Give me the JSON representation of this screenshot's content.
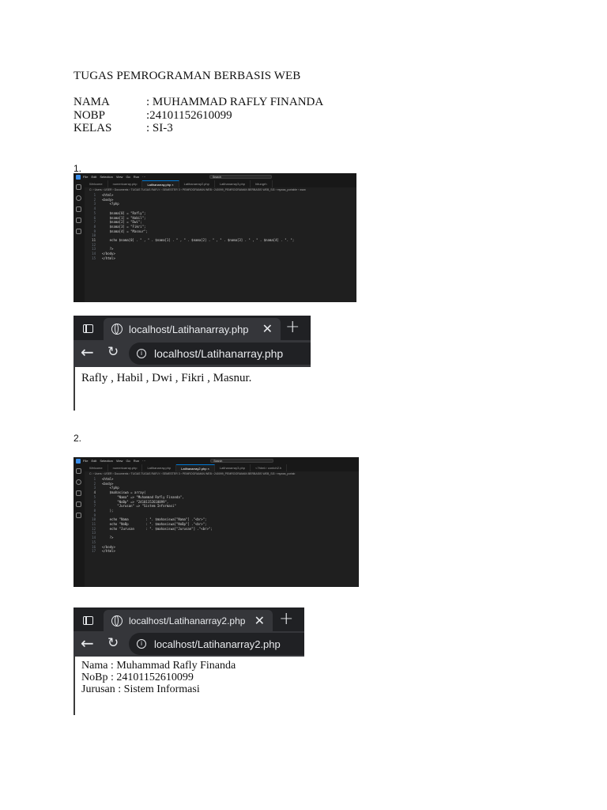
{
  "header": {
    "title": "TUGAS PEMROGRAMAN BERBASIS WEB",
    "fields": [
      {
        "label": "NAMA",
        "value": ": MUHAMMAD RAFLY FINANDA"
      },
      {
        "label": "NOBP",
        "value": ":24101152610099"
      },
      {
        "label": "KELAS",
        "value": ": SI-3"
      }
    ]
  },
  "sections": [
    {
      "number": "1.",
      "editor": {
        "menu": [
          "File",
          "Edit",
          "Selection",
          "View",
          "Go",
          "Run",
          "···"
        ],
        "search": "Search",
        "tabs": [
          "Welcome",
          "numericarray.php",
          "Latihanarray.php ×",
          "Latihanarray2.php",
          "Latihanarray3.php",
          "hitungrh"
        ],
        "active_tab": 2,
        "breadcrumb": "C: › Users › USER › Documents › TUGAS TUGAS RAFLY › SEMESTER 3 › PEMROGRAMAN WEB › 240099_PEMROGRAMAN BERBASIS WEB_SI3 › mywas_portable › www",
        "lines": [
          {
            "n": "1",
            "t": "<html>"
          },
          {
            "n": "2",
            "t": "<body>"
          },
          {
            "n": "3",
            "t": "    <?php"
          },
          {
            "n": "4",
            "t": ""
          },
          {
            "n": "5",
            "t": "    $nama[0] = \"Rafly\";"
          },
          {
            "n": "6",
            "t": "    $nama[1] = \"Habil\";"
          },
          {
            "n": "7",
            "t": "    $nama[2] = \"Dwi\";"
          },
          {
            "n": "8",
            "t": "    $nama[3] = \"Fikri\";"
          },
          {
            "n": "9",
            "t": "    $nama[4] = \"Masnur\";"
          },
          {
            "n": "10",
            "t": ""
          },
          {
            "n": "11",
            "t": "    echo $nama[0] . \" , \" . $nama[1] . \" , \" . $nama[2] . \" , \" . $nama[3] . \" , \" . $nama[4] . \". \";"
          },
          {
            "n": "12",
            "t": ""
          },
          {
            "n": "13",
            "t": "    ?>"
          },
          {
            "n": "14",
            "t": "</body>"
          },
          {
            "n": "15",
            "t": "</html>"
          }
        ],
        "current_line": 10
      },
      "browser": {
        "tab_title": "localhost/Latihanarray.php",
        "url": "localhost/Latihanarray.php",
        "output": "Rafly , Habil , Dwi , Fikri , Masnur."
      }
    },
    {
      "number": "2.",
      "editor": {
        "menu": [
          "File",
          "Edit",
          "Selection",
          "View",
          "Go",
          "Run",
          "···"
        ],
        "search": "Search",
        "tabs": [
          "Welcome",
          "numericarray.php",
          "Latihanarray.php",
          "Latihanarray2.php ×",
          "Latihanarray3.php",
          "<?html> contoh2.h"
        ],
        "active_tab": 3,
        "breadcrumb": "C: › Users › USER › Documents › TUGAS TUGAS RAFLY › SEMESTER 3 › PEMROGRAMAN WEB › 240099_PEMROGRAMAN BERBASIS WEB_SI3 › mywas_portab",
        "lines": [
          {
            "n": "1",
            "t": "<html>"
          },
          {
            "n": "2",
            "t": "<body>"
          },
          {
            "n": "3",
            "t": "    <?php"
          },
          {
            "n": "4",
            "t": "    $mahasiswa = array("
          },
          {
            "n": "5",
            "t": "        \"Nama\" => \"Muhammad Rafly Finanda\","
          },
          {
            "n": "6",
            "t": "        \"NoBp\" => \"24101152610099\","
          },
          {
            "n": "7",
            "t": "        \"Jurusan\" => \"Sistem Informasi\""
          },
          {
            "n": "8",
            "t": "    );"
          },
          {
            "n": "9",
            "t": ""
          },
          {
            "n": "10",
            "t": "    echo \"Nama         : \". $mahasiswa[\"Nama\"] .\"<br>\";"
          },
          {
            "n": "11",
            "t": "    echo \"NoBp         : \". $mahasiswa[\"NoBp\"] .\"<br>\";"
          },
          {
            "n": "12",
            "t": "    echo \"Jurusan      : \". $mahasiswa[\"Jurusan\"] .\"<br>\";"
          },
          {
            "n": "13",
            "t": ""
          },
          {
            "n": "14",
            "t": "    ?>"
          },
          {
            "n": "15",
            "t": ""
          },
          {
            "n": "16",
            "t": "</body>"
          },
          {
            "n": "17",
            "t": "</html>"
          }
        ],
        "current_line": 3
      },
      "browser": {
        "tab_title": "localhost/Latihanarray2.php",
        "url": "localhost/Latihanarray2.php",
        "output": "Nama : Muhammad Rafly Finanda\nNoBp : 24101152610099\nJurusan : Sistem Informasi"
      }
    }
  ],
  "colors": {
    "editor_bg": "#1f1f1f",
    "browser_chrome": "#202124",
    "accent": "#0078d4"
  }
}
